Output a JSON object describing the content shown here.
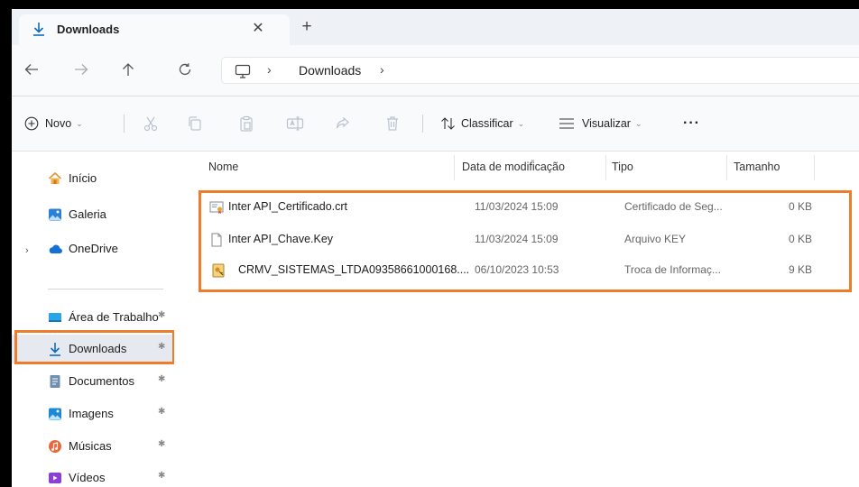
{
  "tab": {
    "title": "Downloads",
    "close": "✕",
    "new_tab": "+"
  },
  "address": {
    "separator": "›",
    "crumb": "Downloads"
  },
  "commands": {
    "new": "Novo",
    "sort": "Classificar",
    "view": "Visualizar",
    "more": "···"
  },
  "nav": {
    "items": [
      {
        "label": "Início"
      },
      {
        "label": "Galeria"
      },
      {
        "label": "OneDrive"
      },
      {
        "label": "Área de Trabalho"
      },
      {
        "label": "Downloads"
      },
      {
        "label": "Documentos"
      },
      {
        "label": "Imagens"
      },
      {
        "label": "Músicas"
      },
      {
        "label": "Vídeos"
      }
    ],
    "expand_glyph": "›",
    "pin_glyph": "📌"
  },
  "columns": {
    "name": "Nome",
    "date": "Data de modificação",
    "type": "Tipo",
    "size": "Tamanho"
  },
  "files": [
    {
      "name": "Inter API_Certificado.crt",
      "date": "11/03/2024 15:09",
      "type": "Certificado de Seg...",
      "size": "0 KB",
      "icon": "certificate-icon"
    },
    {
      "name": "Inter API_Chave.Key",
      "date": "11/03/2024 15:09",
      "type": "Arquivo KEY",
      "size": "0 KB",
      "icon": "generic-file-icon"
    },
    {
      "name": "CRMV_SISTEMAS_LTDA09358661000168....",
      "date": "06/10/2023 10:53",
      "type": "Troca de Informaç...",
      "size": "9 KB",
      "icon": "personal-info-exchange-icon"
    }
  ],
  "colors": {
    "highlight": "#ec7d2c",
    "accent": "#0f6cbd"
  }
}
